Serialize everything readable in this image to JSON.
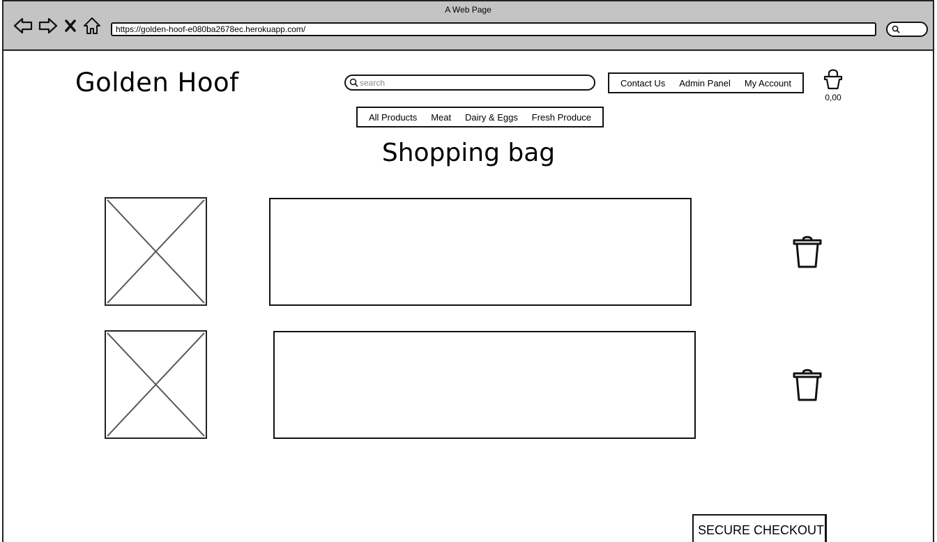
{
  "browser": {
    "window_title": "A Web Page",
    "url": "https://golden-hoof-e080ba2678ec.herokuapp.com/"
  },
  "header": {
    "logo": "Golden Hoof",
    "search_placeholder": "search",
    "top_links": [
      "Contact Us",
      "Admin Panel",
      "My Account"
    ],
    "bag_total": "0,00"
  },
  "categories": [
    "All Products",
    "Meat",
    "Dairy & Eggs",
    "Fresh Produce"
  ],
  "main": {
    "title": "Shopping bag",
    "checkout_label": "SECURE CHECKOUT"
  },
  "icons": {
    "back": "arrow-left-icon",
    "forward": "arrow-right-icon",
    "close": "close-icon",
    "home": "home-icon",
    "search": "search-icon",
    "bag": "shopping-bag-icon",
    "trash": "trash-icon"
  }
}
